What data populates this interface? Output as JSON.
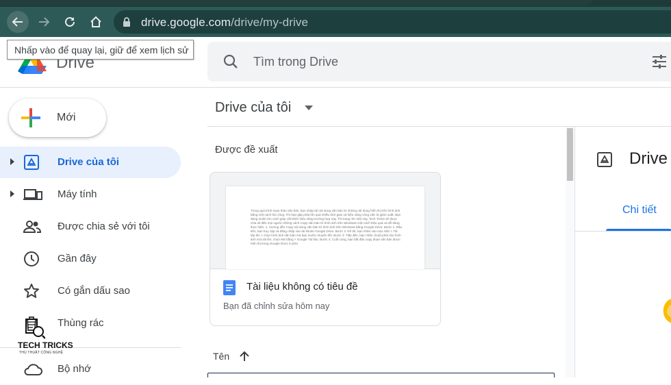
{
  "browser": {
    "url_host": "drive.google.com",
    "url_path": "/drive/my-drive",
    "back_tooltip": "Nhấp vào để quay lại, giữ để xem lịch sử"
  },
  "header": {
    "app_name": "Drive",
    "search_placeholder": "Tìm trong Drive"
  },
  "sidebar": {
    "new_label": "Mới",
    "items": [
      {
        "label": "Drive của tôi",
        "icon": "my-drive-icon",
        "active": true,
        "expandable": true
      },
      {
        "label": "Máy tính",
        "icon": "computers-icon",
        "active": false,
        "expandable": true
      },
      {
        "label": "Được chia sẻ với tôi",
        "icon": "shared-people-icon",
        "active": false,
        "expandable": false
      },
      {
        "label": "Gần đây",
        "icon": "clock-icon",
        "active": false,
        "expandable": false
      },
      {
        "label": "Có gắn dấu sao",
        "icon": "star-icon",
        "active": false,
        "expandable": false
      },
      {
        "label": "Thùng rác",
        "icon": "trash-icon",
        "active": false,
        "expandable": false
      },
      {
        "label": "Bộ nhớ",
        "icon": "cloud-icon",
        "active": false,
        "expandable": false
      }
    ]
  },
  "watermark": {
    "title": "TECH TRICKS",
    "subtitle": "THỦ THUẬT CÔNG NGHỆ"
  },
  "main": {
    "title": "Drive của tôi",
    "suggested_heading": "Được đề xuất",
    "suggested_file": {
      "name": "Tài liệu không có tiêu đề",
      "activity": "Bạn đã chỉnh sửa hôm nay",
      "preview_text": "Trong quá trình soạn thảo văn bản, bạn nhập tài nội dung văn bản từ những nội dung hiển thị trên hình ảnh bằng một cách thủ công. Thì bạn gặp phải tốn quá nhiều thời gian và hiệu năng công việc bị giảm xuất. Bạn đang muốn tìm cách giúp cắt thiên hiệu năng trường hợp này. Thì trang Tin Việt này, Tech Tricks sẽ được chia sẻ đến mọi người những cách Copy văn bản từ hình ảnh trên Windows một cách hiệu quả và dễ dàng thực hiện. 1. Hướng dẫn Copy nội dung văn bản từ hình ảnh trên Windows bằng Google Drive. Bước 1: Đầu tiên, bạn truy cập và đăng nhập vào tài khoản Google Drive. Bước 2: Kế đó, bạn nhấn vào mục Mới > Tải tệp lên > chọn hình ảnh văn bản mà bạn muốn chuyển đổi. Bước 3: Tiếp đến, bạn nhấn chuột phải vào hình ảnh vừa tải lên, chọn Mở bằng > Google Tài liệu. Bước 4: Cuối cùng, bạn bắt đầu copy đoạn văn bản được hiển thị trong Google Docs ở phía"
    },
    "sort_label": "Tên"
  },
  "details": {
    "title": "Drive",
    "tab": "Chi tiết"
  },
  "colors": {
    "accent": "#1a73e8",
    "active_bg": "#e8f0fe",
    "active_text": "#1967d2",
    "browser_toolbar": "#2d5a57"
  }
}
